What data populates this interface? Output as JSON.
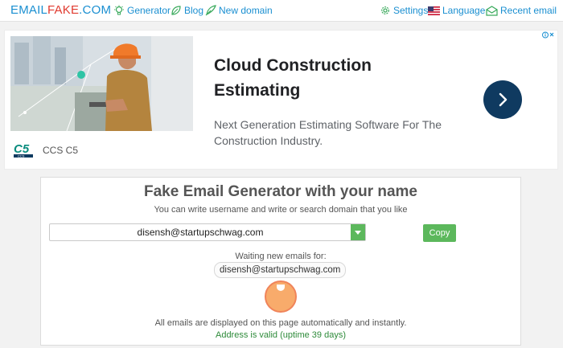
{
  "brand": {
    "part1": "EMAIL",
    "part2": "FAKE",
    "part3": ".COM"
  },
  "nav_left": [
    {
      "label": "Generator",
      "icon": "lightbulb-icon"
    },
    {
      "label": "Blog",
      "icon": "leaf-icon"
    },
    {
      "label": "New domain",
      "icon": "quill-icon"
    }
  ],
  "nav_right": [
    {
      "label": "Settings",
      "icon": "gear-icon"
    },
    {
      "label": "Language",
      "icon": "us-flag-icon"
    },
    {
      "label": "Recent email",
      "icon": "envelope-icon"
    }
  ],
  "ad": {
    "title": "Cloud Construction Estimating",
    "description": "Next Generation Estimating Software For The Construction Industry.",
    "brand_name": "CCS C5",
    "logo_text": "C5",
    "logo_sub": "CCS",
    "choices_icon": "adchoices-icon",
    "arrow_icon": "chevron-right-icon"
  },
  "generator": {
    "title": "Fake Email Generator with your name",
    "subtitle": "You can write username and write or search domain that you like",
    "email_value": "disensh@startupschwag.com",
    "copy_label": "Copy",
    "waiting_label": "Waiting new emails for:",
    "waiting_email": "disensh@startupschwag.com",
    "note": "All emails are displayed on this page automatically and instantly.",
    "valid_text": "Address is valid (uptime 39 days)"
  },
  "colors": {
    "link": "#1a8fd1",
    "brand_accent": "#e03a2f",
    "button_green": "#5cb85c",
    "ad_navy": "#0f3a60",
    "valid_green": "#2e8b3a"
  }
}
